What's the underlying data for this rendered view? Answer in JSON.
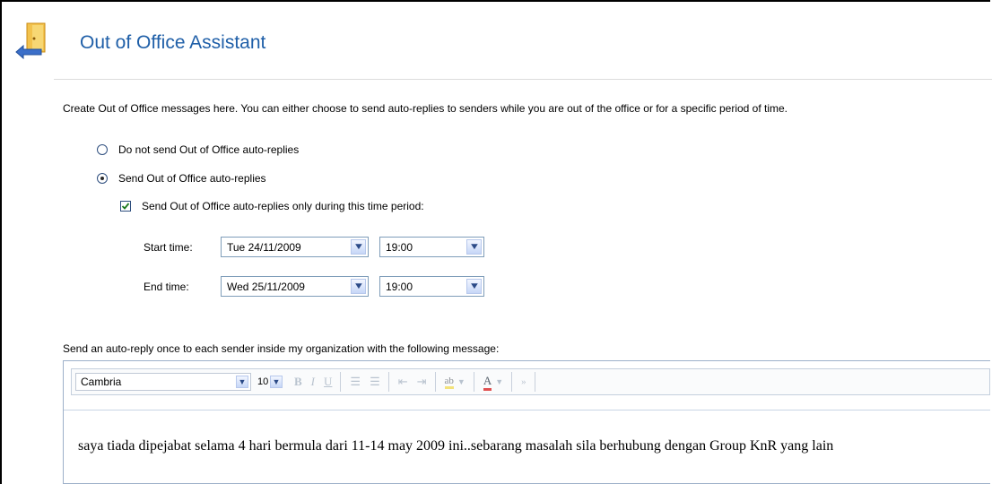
{
  "header": {
    "title": "Out of Office Assistant",
    "icon": "out-of-office-door-icon"
  },
  "intro": "Create Out of Office messages here. You can either choose to send auto-replies to senders while you are out of the office or for a specific period of time.",
  "options": {
    "no_reply": {
      "label": "Do not send Out of Office auto-replies",
      "selected": false
    },
    "send_reply": {
      "label": "Send Out of Office auto-replies",
      "selected": true
    }
  },
  "time_period": {
    "label": "Send Out of Office auto-replies only during this time period:",
    "checked": true
  },
  "start": {
    "label": "Start time:",
    "date": "Tue 24/11/2009",
    "time": "19:00"
  },
  "end": {
    "label": "End time:",
    "date": "Wed 25/11/2009",
    "time": "19:00"
  },
  "message_label": "Send an auto-reply once to each sender inside my organization with the following message:",
  "editor": {
    "font": "Cambria",
    "size": "10",
    "body": "saya tiada dipejabat selama 4 hari bermula dari 11-14 may 2009 ini..sebarang masalah sila berhubung dengan Group KnR yang lain"
  },
  "colors": {
    "title": "#1f5fa8",
    "accent": "#2b4a87"
  }
}
